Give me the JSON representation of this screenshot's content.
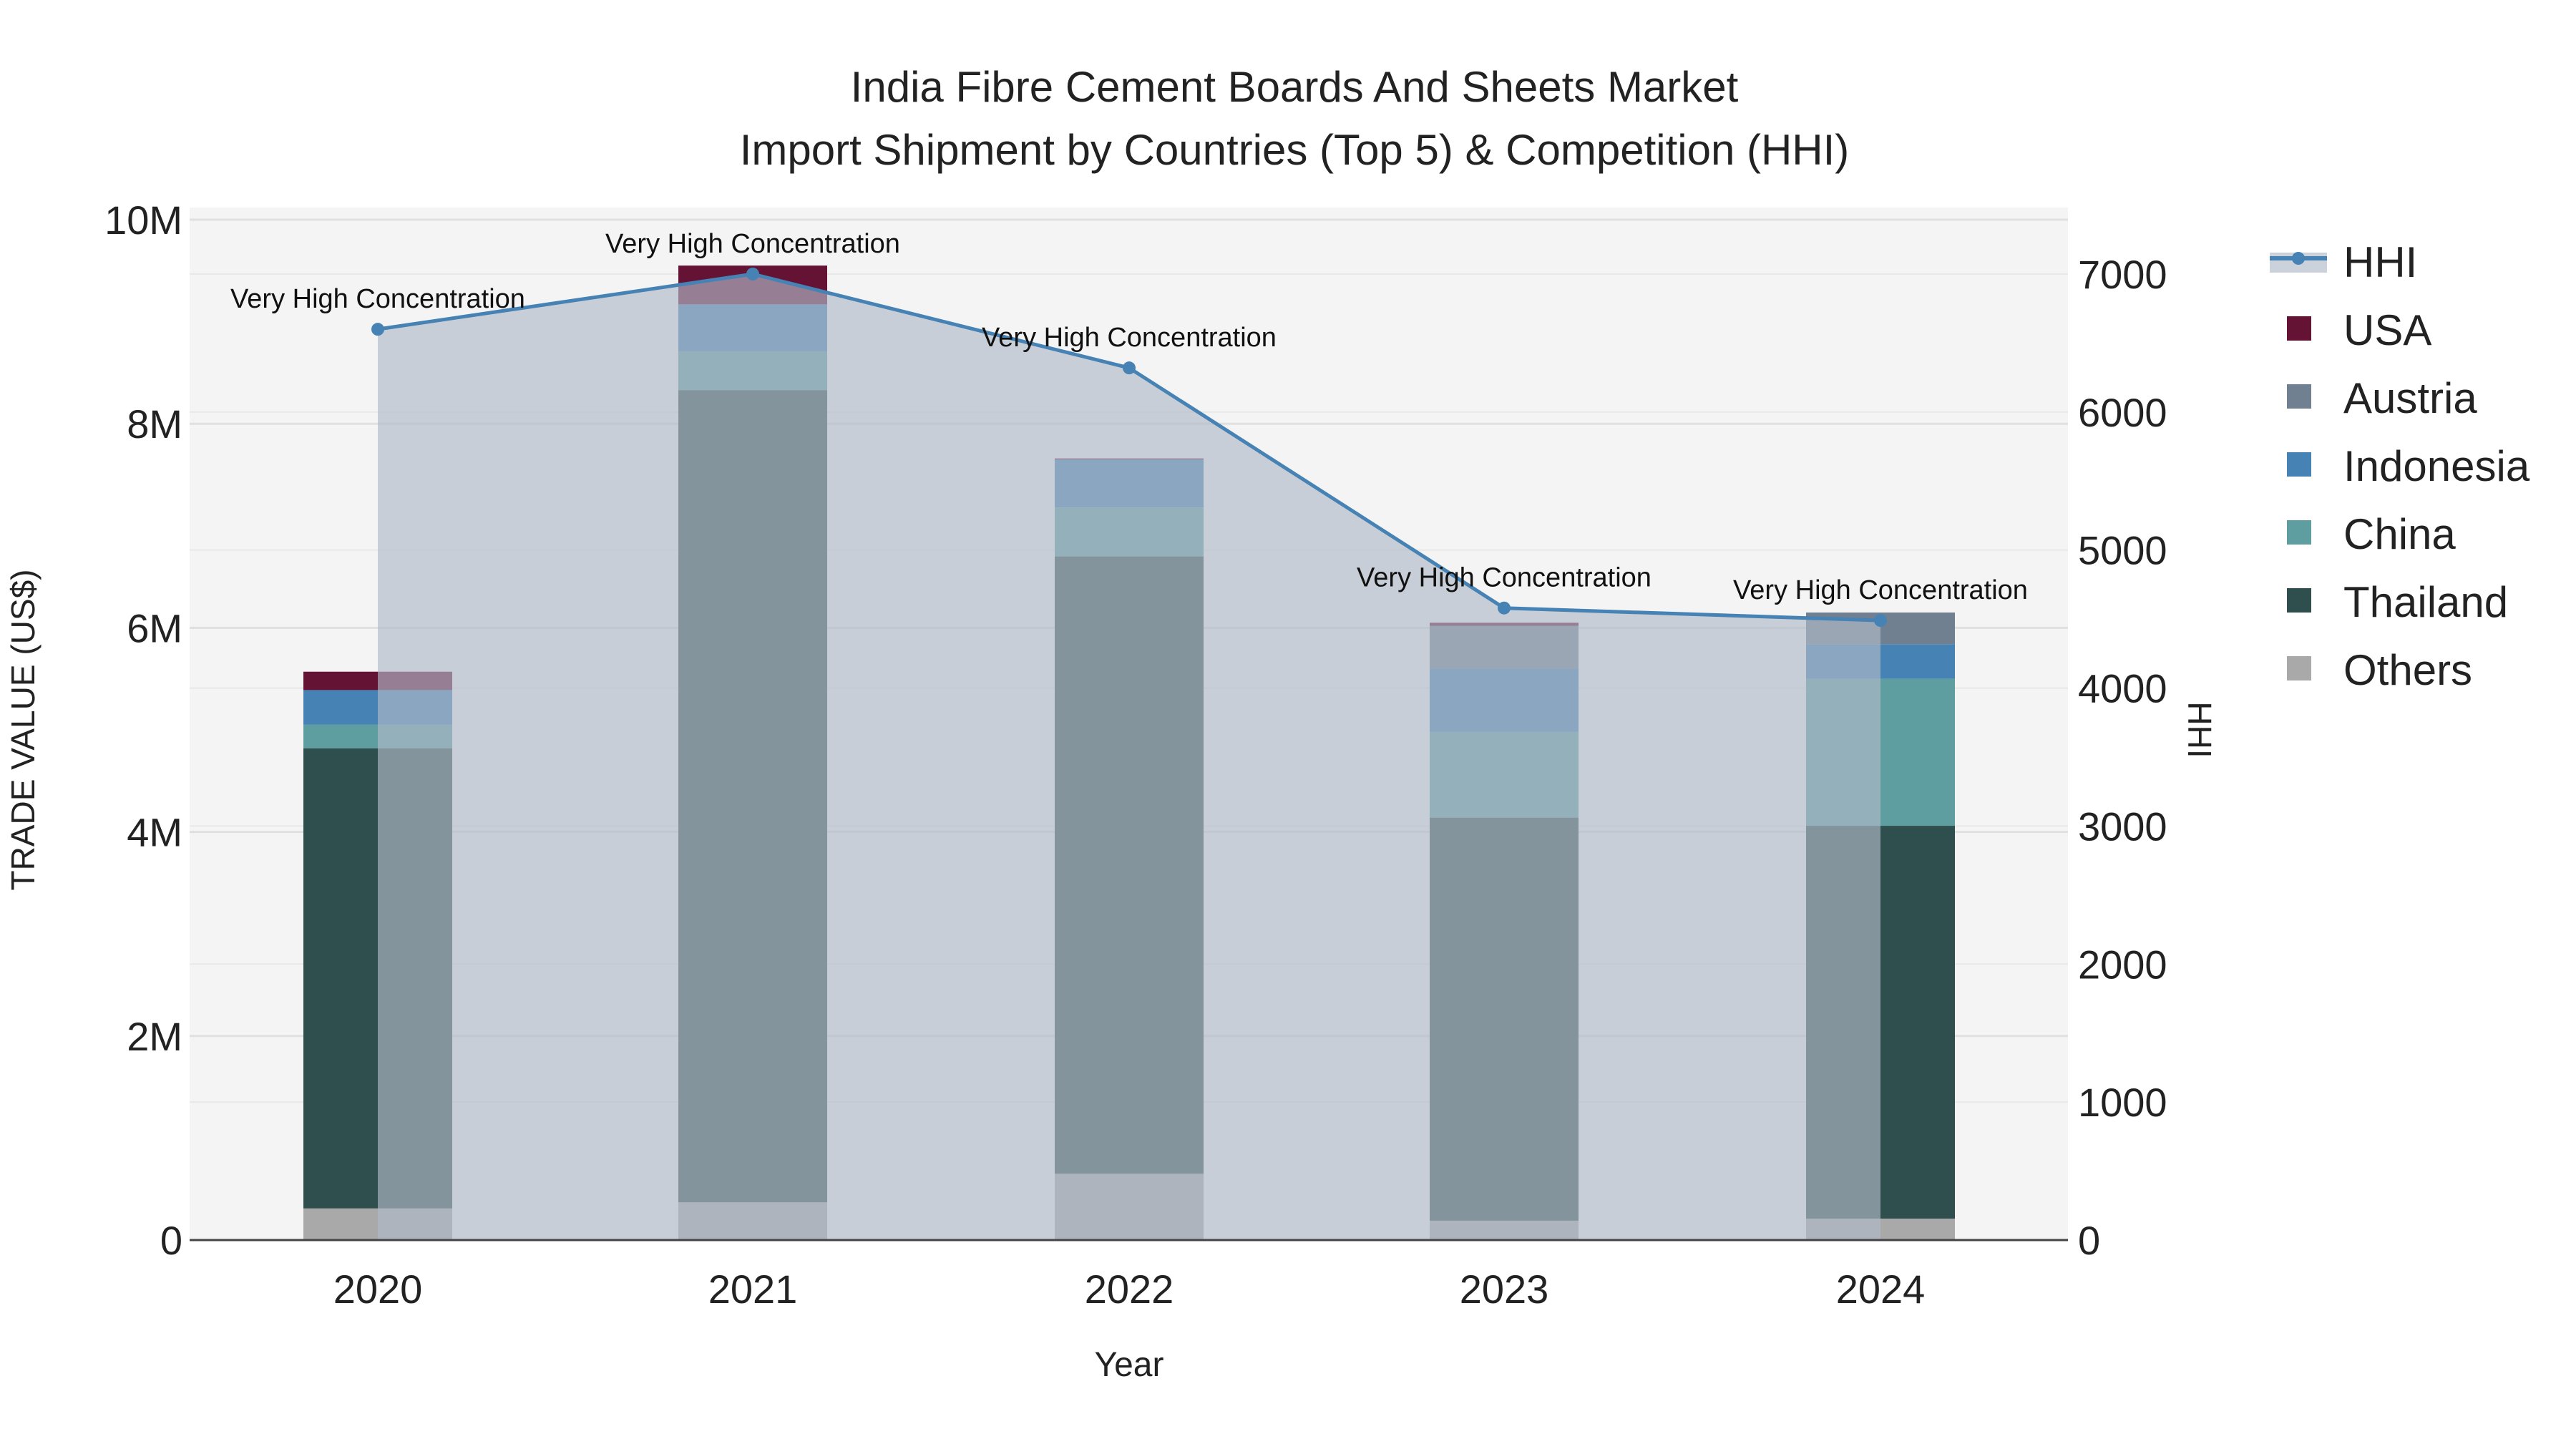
{
  "chart_data": {
    "type": "bar",
    "stacked": true,
    "title": "India Fibre Cement Boards And Sheets Market",
    "subtitle": "Import Shipment by Countries (Top 5) & Competition (HHI)",
    "xlabel": "Year",
    "ylabel": "TRADE VALUE (US$)",
    "y2label": "HHI",
    "categories": [
      "2020",
      "2021",
      "2022",
      "2023",
      "2024"
    ],
    "ylim": [
      0,
      10000000
    ],
    "y_ticks": [
      "0",
      "2M",
      "4M",
      "6M",
      "8M",
      "10M"
    ],
    "y2lim": [
      0,
      7500
    ],
    "y2_ticks": [
      "0",
      "1000",
      "2000",
      "3000",
      "4000",
      "5000",
      "6000",
      "7000"
    ],
    "series": [
      {
        "name": "Others",
        "color": "#a9a9a9",
        "values": [
          310000,
          370000,
          650000,
          190000,
          210000
        ]
      },
      {
        "name": "Thailand",
        "color": "#2f4f4f",
        "values": [
          4510000,
          7960000,
          6050000,
          3950000,
          3850000
        ]
      },
      {
        "name": "China",
        "color": "#5f9ea0",
        "values": [
          230000,
          380000,
          480000,
          840000,
          1440000
        ]
      },
      {
        "name": "Indonesia",
        "color": "#4682b4",
        "values": [
          340000,
          460000,
          470000,
          620000,
          340000
        ]
      },
      {
        "name": "Austria",
        "color": "#708090",
        "values": [
          0,
          0,
          0,
          420000,
          310000
        ]
      },
      {
        "name": "USA",
        "color": "#641334",
        "values": [
          180000,
          380000,
          10000,
          30000,
          0
        ]
      }
    ],
    "line": {
      "name": "HHI",
      "color": "#4682b4",
      "values": [
        6600,
        7000,
        6320,
        4580,
        4490
      ],
      "annotations": [
        "Very High Concentration",
        "Very High Concentration",
        "Very High Concentration",
        "Very High Concentration",
        "Very High Concentration"
      ]
    },
    "legend": [
      "HHI",
      "USA",
      "Austria",
      "Indonesia",
      "China",
      "Thailand",
      "Others"
    ],
    "legend_position": "right",
    "grid": true
  }
}
